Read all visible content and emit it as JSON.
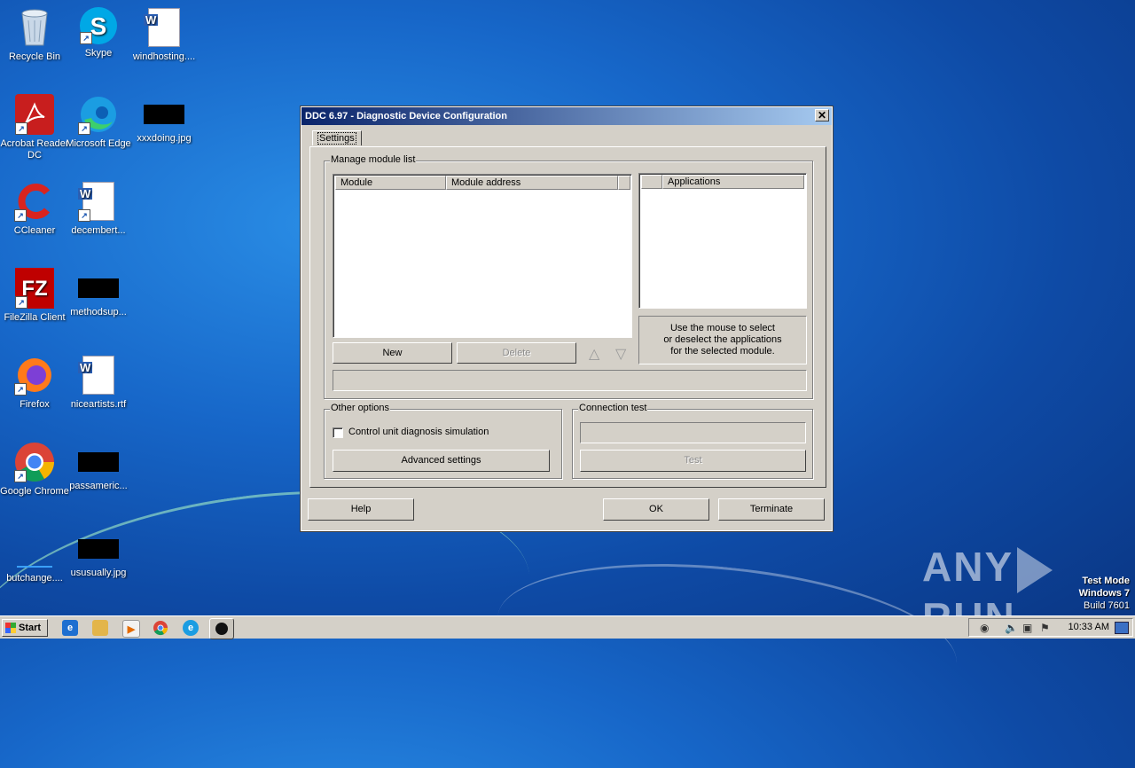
{
  "desktop": {
    "icons": [
      {
        "name": "recycle-bin",
        "label": "Recycle Bin"
      },
      {
        "name": "skype",
        "label": "Skype"
      },
      {
        "name": "windhosting",
        "label": "windhosting...."
      },
      {
        "name": "acrobat",
        "label": "Acrobat Reader DC"
      },
      {
        "name": "edge",
        "label": "Microsoft Edge"
      },
      {
        "name": "xxxdoing",
        "label": "xxxdoing.jpg"
      },
      {
        "name": "ccleaner",
        "label": "CCleaner"
      },
      {
        "name": "decembert",
        "label": "decembert..."
      },
      {
        "name": "filezilla",
        "label": "FileZilla Client"
      },
      {
        "name": "methodsup",
        "label": "methodsup..."
      },
      {
        "name": "firefox",
        "label": "Firefox"
      },
      {
        "name": "niceartists",
        "label": "niceartists.rtf"
      },
      {
        "name": "chrome",
        "label": "Google Chrome"
      },
      {
        "name": "passameric",
        "label": "passameric..."
      },
      {
        "name": "butchange",
        "label": "butchange...."
      },
      {
        "name": "ususually",
        "label": "ususually.jpg"
      }
    ]
  },
  "dialog": {
    "title": "DDC 6.97 - Diagnostic Device Configuration",
    "close_glyph": "✕",
    "tab": "Settings",
    "manage_group": "Manage module list",
    "columns": [
      "Module",
      "Module address"
    ],
    "applications_header": "Applications",
    "info_lines": [
      "Use the mouse to select",
      "or deselect the applications",
      "for the selected module."
    ],
    "new_button": "New",
    "delete_button": "Delete",
    "up_glyph": "△",
    "down_glyph": "▽",
    "other_options_group": "Other options",
    "control_unit_checkbox": "Control unit diagnosis simulation",
    "control_unit_checked": false,
    "advanced_settings_button": "Advanced settings",
    "connection_test_group": "Connection test",
    "test_button": "Test",
    "help_button": "Help",
    "ok_button": "OK",
    "terminate_button": "Terminate"
  },
  "watermark": {
    "text_left": "ANY",
    "text_right": "RUN"
  },
  "test_mode": {
    "line1": "Test Mode",
    "line2": "Windows 7",
    "line3": "Build 7601"
  },
  "taskbar": {
    "start_label": "Start",
    "clock": "10:33 AM"
  }
}
